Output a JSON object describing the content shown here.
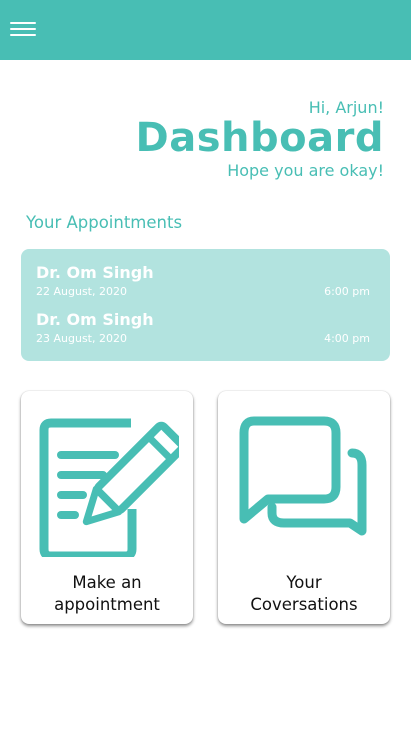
{
  "colors": {
    "accent": "#48beb4",
    "card_bg": "#b2e3df",
    "text_dark": "#111111"
  },
  "appbar": {
    "menu_icon": "hamburger-menu-icon"
  },
  "header": {
    "greeting": "Hi, Arjun!",
    "title": "Dashboard",
    "subtitle": "Hope you are okay!"
  },
  "appointments": {
    "heading": "Your Appointments",
    "items": [
      {
        "doctor": "Dr. Om Singh",
        "date": "22 August, 2020",
        "time": "6:00 pm"
      },
      {
        "doctor": "Dr. Om Singh",
        "date": "23 August, 2020",
        "time": "4:00 pm"
      }
    ]
  },
  "tiles": [
    {
      "label": "Make an\nappointment",
      "icon": "edit-document-icon"
    },
    {
      "label": "Your\nCoversations",
      "icon": "chat-bubbles-icon"
    }
  ]
}
